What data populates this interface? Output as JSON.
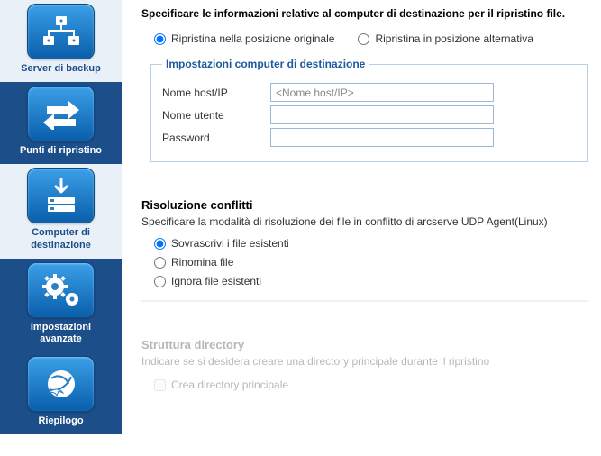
{
  "sidebar": {
    "items": [
      {
        "label": "Server di backup"
      },
      {
        "label": "Punti di ripristino"
      },
      {
        "label": "Computer di\ndestinazione"
      },
      {
        "label": "Impostazioni\navanzate"
      },
      {
        "label": "Riepilogo"
      }
    ]
  },
  "page": {
    "title": "Specificare le informazioni relative al computer di destinazione per il ripristino file."
  },
  "location_radio": {
    "original": "Ripristina nella posizione originale",
    "alternate": "Ripristina in posizione alternativa"
  },
  "dest_group": {
    "legend": "Impostazioni computer di destinazione",
    "host_label": "Nome host/IP",
    "host_placeholder": "<Nome host/IP>",
    "host_value": "",
    "user_label": "Nome utente",
    "user_value": "",
    "pass_label": "Password",
    "pass_value": ""
  },
  "conflict": {
    "title": "Risoluzione conflitti",
    "desc": "Specificare la modalità di risoluzione dei file in conflitto di arcserve UDP Agent(Linux)",
    "overwrite": "Sovrascrivi i file esistenti",
    "rename": "Rinomina file",
    "ignore": "Ignora file esistenti"
  },
  "dir": {
    "title": "Struttura directory",
    "desc": "Indicare se si desidera creare una directory principale durante il ripristino",
    "create": "Crea directory principale"
  }
}
